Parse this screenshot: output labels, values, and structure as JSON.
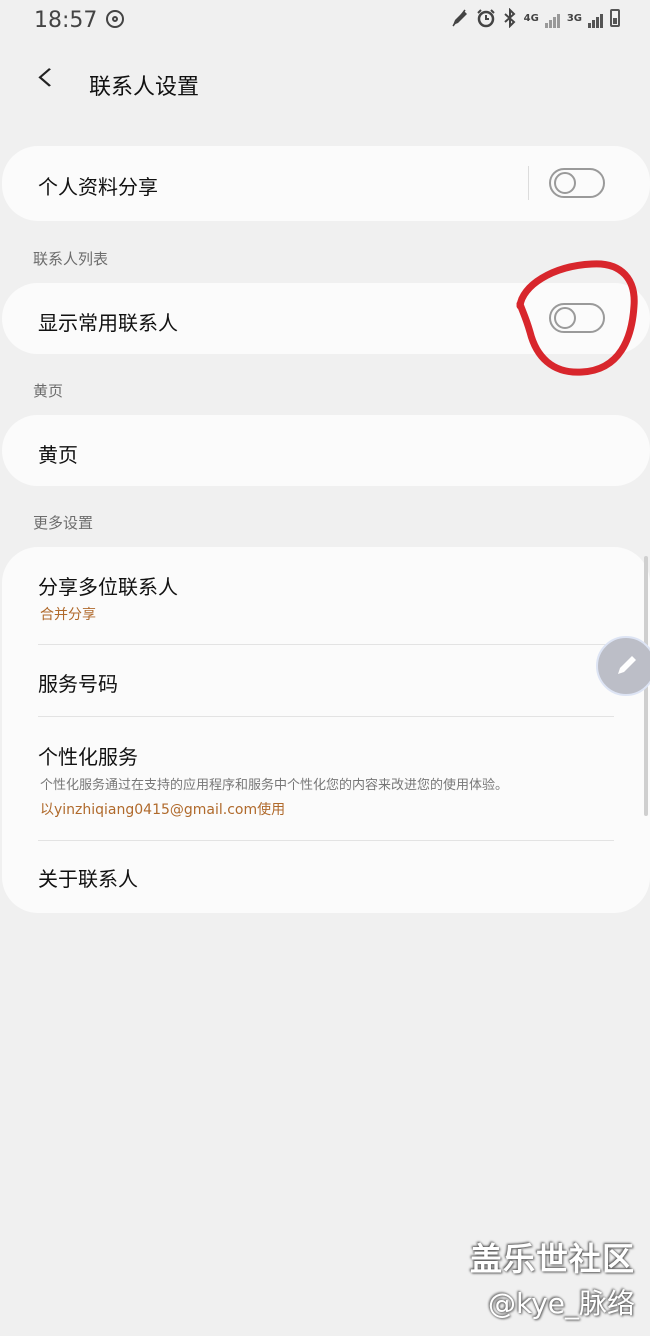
{
  "status_bar": {
    "time": "18:57",
    "network1": "4G",
    "network2": "3G"
  },
  "header": {
    "title": "联系人设置"
  },
  "profile_share": {
    "label": "个人资料分享",
    "enabled": false
  },
  "contacts_list": {
    "section_title": "联系人列表",
    "show_frequent_label": "显示常用联系人",
    "show_frequent_enabled": false
  },
  "yellow_pages": {
    "section_title": "黄页",
    "item_label": "黄页"
  },
  "more_settings": {
    "section_title": "更多设置",
    "share_multiple_label": "分享多位联系人",
    "share_multiple_sub": "合并分享",
    "service_number_label": "服务号码",
    "personalization_label": "个性化服务",
    "personalization_desc": "个性化服务通过在支持的应用程序和服务中个性化您的内容来改进您的使用体验。",
    "personalization_account": "以yinzhiqiang0415@gmail.com使用",
    "about_label": "关于联系人"
  },
  "watermark": {
    "line1": "盖乐世社区",
    "line2": "@kye_脉络"
  },
  "colors": {
    "accent_orange": "#b06a2c",
    "annotation_red": "#d8262c"
  }
}
